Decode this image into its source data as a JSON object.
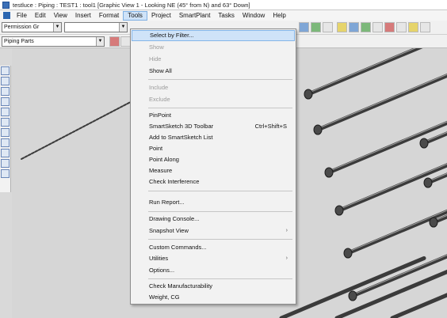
{
  "window": {
    "title": "testluce : Piping : TEST1 : tool1   [Graphic View 1 - Looking NE (45° from N) and 63° Down]"
  },
  "menubar": {
    "items": [
      {
        "label": "File"
      },
      {
        "label": "Edit"
      },
      {
        "label": "View"
      },
      {
        "label": "Insert"
      },
      {
        "label": "Format"
      },
      {
        "label": "Tools"
      },
      {
        "label": "Project"
      },
      {
        "label": "SmartPlant"
      },
      {
        "label": "Tasks"
      },
      {
        "label": "Window"
      },
      {
        "label": "Help"
      }
    ],
    "active_index": 5
  },
  "toolbar": {
    "combo1": "Permission Gr",
    "combo2": "",
    "combo3": "Piping Parts"
  },
  "tools_menu": {
    "items": [
      {
        "label": "Select by Filter...",
        "state": "hover"
      },
      {
        "label": "Show",
        "state": "disabled"
      },
      {
        "label": "Hide",
        "state": "disabled"
      },
      {
        "label": "Show All",
        "state": "normal"
      },
      {
        "label": "Include",
        "state": "disabled"
      },
      {
        "label": "Exclude",
        "state": "disabled"
      },
      {
        "label": "PinPoint",
        "state": "normal"
      },
      {
        "label": "SmartSketch 3D Toolbar",
        "state": "normal",
        "shortcut": "Ctrl+Shift+S"
      },
      {
        "label": "Add to SmartSketch List",
        "state": "normal"
      },
      {
        "label": "Point",
        "state": "normal"
      },
      {
        "label": "Point Along",
        "state": "normal"
      },
      {
        "label": "Measure",
        "state": "normal"
      },
      {
        "label": "Check Interference",
        "state": "normal"
      },
      {
        "label": "Run Report...",
        "state": "normal"
      },
      {
        "label": "Drawing Console...",
        "state": "normal"
      },
      {
        "label": "Snapshot View",
        "state": "normal",
        "submenu": "›"
      },
      {
        "label": "Custom Commands...",
        "state": "normal"
      },
      {
        "label": "Utilities",
        "state": "normal",
        "submenu": "›"
      },
      {
        "label": "Options...",
        "state": "normal"
      },
      {
        "label": "Check Manufacturability",
        "state": "normal"
      },
      {
        "label": "Weight, CG",
        "state": "normal"
      }
    ]
  },
  "colors": {
    "hover_bg": "#cfe3f8",
    "hover_border": "#84b5e8",
    "pipe_dark": "#3b3b3b",
    "pipe_light": "#9a9a9a",
    "viewport_bg": "#d6d6d6"
  }
}
